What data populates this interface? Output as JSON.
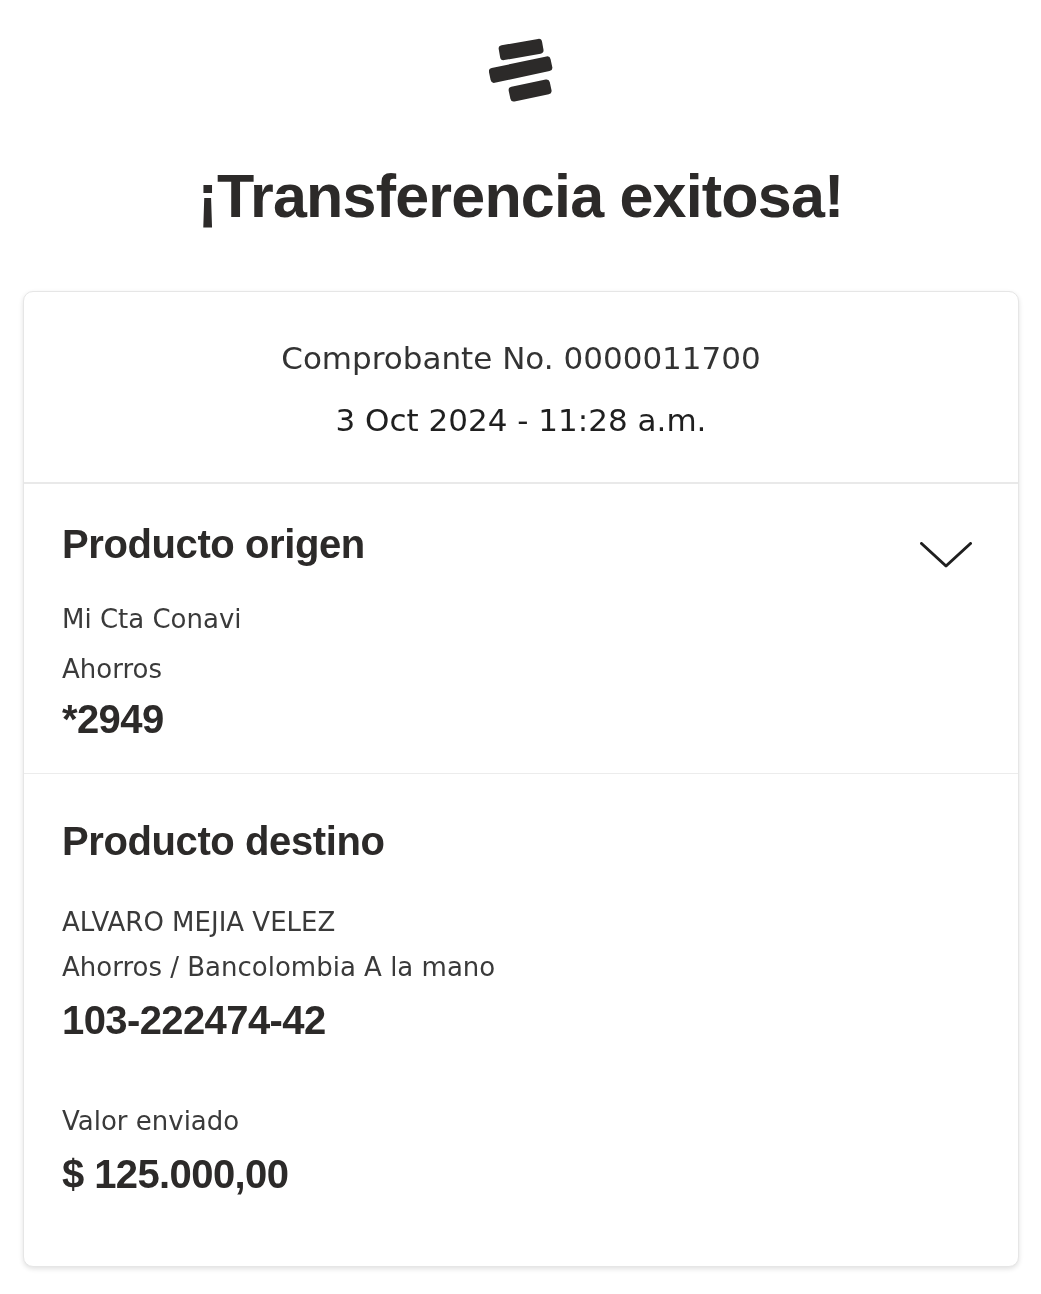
{
  "title": "¡Transferencia exitosa!",
  "receipt": {
    "number": "Comprobante No. 0000011700",
    "datetime": "3 Oct 2024 - 11:28 a.m."
  },
  "sections": [
    {
      "kind": "origin",
      "heading": "Producto origen",
      "collapsible": true,
      "lines": [
        "Mi Cta Conavi",
        "Ahorros"
      ],
      "account": "*2949"
    },
    {
      "kind": "destination",
      "heading": "Producto destino",
      "collapsible": false,
      "lines": [
        "ALVARO MEJIA VELEZ",
        "Ahorros / Bancolombia A la mano"
      ],
      "account": "103-222474-42",
      "amount_label": "Valor enviado",
      "amount": "$ 125.000,00"
    }
  ]
}
